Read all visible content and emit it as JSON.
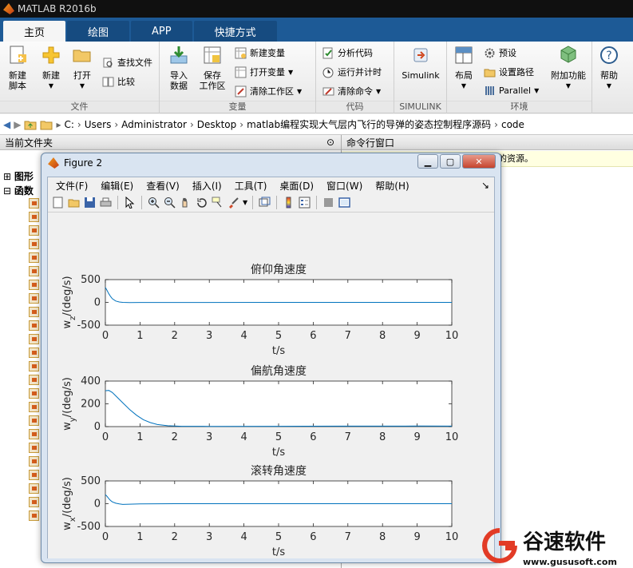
{
  "app": {
    "title": "MATLAB R2016b"
  },
  "tabs": [
    {
      "label": "主页",
      "active": true
    },
    {
      "label": "绘图"
    },
    {
      "label": "APP"
    },
    {
      "label": "快捷方式"
    }
  ],
  "ribbon": {
    "file": {
      "label": "文件",
      "new_script": "新建\n脚本",
      "new": "新建",
      "open": "打开",
      "find_files": "查找文件",
      "compare": "比较"
    },
    "variable": {
      "label": "变量",
      "import": "导入\n数据",
      "save_ws": "保存\n工作区",
      "new_var": "新建变量",
      "open_var": "打开变量",
      "clear_ws": "清除工作区"
    },
    "code": {
      "label": "代码",
      "analyze": "分析代码",
      "run_time": "运行并计时",
      "clear_cmd": "清除命令"
    },
    "simulink": {
      "label": "SIMULINK",
      "simulink": "Simulink"
    },
    "env": {
      "label": "环境",
      "layout": "布局",
      "prefs": "预设",
      "set_path": "设置路径",
      "parallel": "Parallel",
      "addons": "附加功能"
    },
    "help": {
      "help": "帮助"
    }
  },
  "address": {
    "crumbs": [
      "C:",
      "Users",
      "Administrator",
      "Desktop",
      "matlab编程实现大气层内飞行的导弹的姿态控制程序源码",
      "code"
    ]
  },
  "panels": {
    "current_folder": "当前文件夹",
    "command_window": "命令行窗口",
    "info_text": "的资源。",
    "tree": {
      "graphics": "图形",
      "functions": "函数"
    }
  },
  "figure": {
    "title": "Figure 2",
    "menus": [
      "文件(F)",
      "编辑(E)",
      "查看(V)",
      "插入(I)",
      "工具(T)",
      "桌面(D)",
      "窗口(W)",
      "帮助(H)"
    ]
  },
  "chart_data": [
    {
      "type": "line",
      "title": "俯仰角速度",
      "xlabel": "t/s",
      "ylabel_main": "w",
      "ylabel_sub": "z",
      "ylabel_tail": "/(deg/s)",
      "xlim": [
        0,
        10
      ],
      "ylim": [
        -500,
        500
      ],
      "yticks": [
        -500,
        0,
        500
      ],
      "xticks": [
        0,
        1,
        2,
        3,
        4,
        5,
        6,
        7,
        8,
        9,
        10
      ],
      "series": [
        {
          "x": [
            0,
            0.05,
            0.1,
            0.15,
            0.2,
            0.3,
            0.4,
            0.5,
            0.7,
            1,
            2,
            5,
            10
          ],
          "y": [
            330,
            260,
            190,
            130,
            80,
            30,
            8,
            0,
            -3,
            -2,
            -1,
            0,
            0
          ]
        }
      ]
    },
    {
      "type": "line",
      "title": "偏航角速度",
      "xlabel": "t/s",
      "ylabel_main": "w",
      "ylabel_sub": "y",
      "ylabel_tail": "/(deg/s)",
      "xlim": [
        0,
        10
      ],
      "ylim": [
        0,
        400
      ],
      "yticks": [
        0,
        200,
        400
      ],
      "xticks": [
        0,
        1,
        2,
        3,
        4,
        5,
        6,
        7,
        8,
        9,
        10
      ],
      "series": [
        {
          "x": [
            0,
            0.1,
            0.2,
            0.3,
            0.5,
            0.7,
            0.9,
            1.1,
            1.3,
            1.5,
            1.8,
            2.2,
            3,
            5,
            7,
            9,
            10
          ],
          "y": [
            315,
            318,
            300,
            270,
            210,
            150,
            100,
            60,
            35,
            18,
            8,
            3,
            2,
            3,
            4,
            5,
            4
          ]
        }
      ]
    },
    {
      "type": "line",
      "title": "滚转角速度",
      "xlabel": "t/s",
      "ylabel_main": "w",
      "ylabel_sub": "x",
      "ylabel_tail": "/(deg/s)",
      "xlim": [
        0,
        10
      ],
      "ylim": [
        -500,
        500
      ],
      "yticks": [
        -500,
        0,
        500
      ],
      "xticks": [
        0,
        1,
        2,
        3,
        4,
        5,
        6,
        7,
        8,
        9,
        10
      ],
      "series": [
        {
          "x": [
            0,
            0.05,
            0.1,
            0.15,
            0.2,
            0.3,
            0.4,
            0.5,
            0.7,
            1,
            2,
            5,
            10
          ],
          "y": [
            200,
            160,
            110,
            70,
            40,
            10,
            -5,
            -15,
            -10,
            -5,
            0,
            0,
            0
          ]
        }
      ]
    }
  ],
  "watermark": {
    "brand": "谷速软件",
    "url": "www.gususoft.com"
  },
  "colors": {
    "line": "#0072bd",
    "tab_bar": "#1d5a96"
  }
}
